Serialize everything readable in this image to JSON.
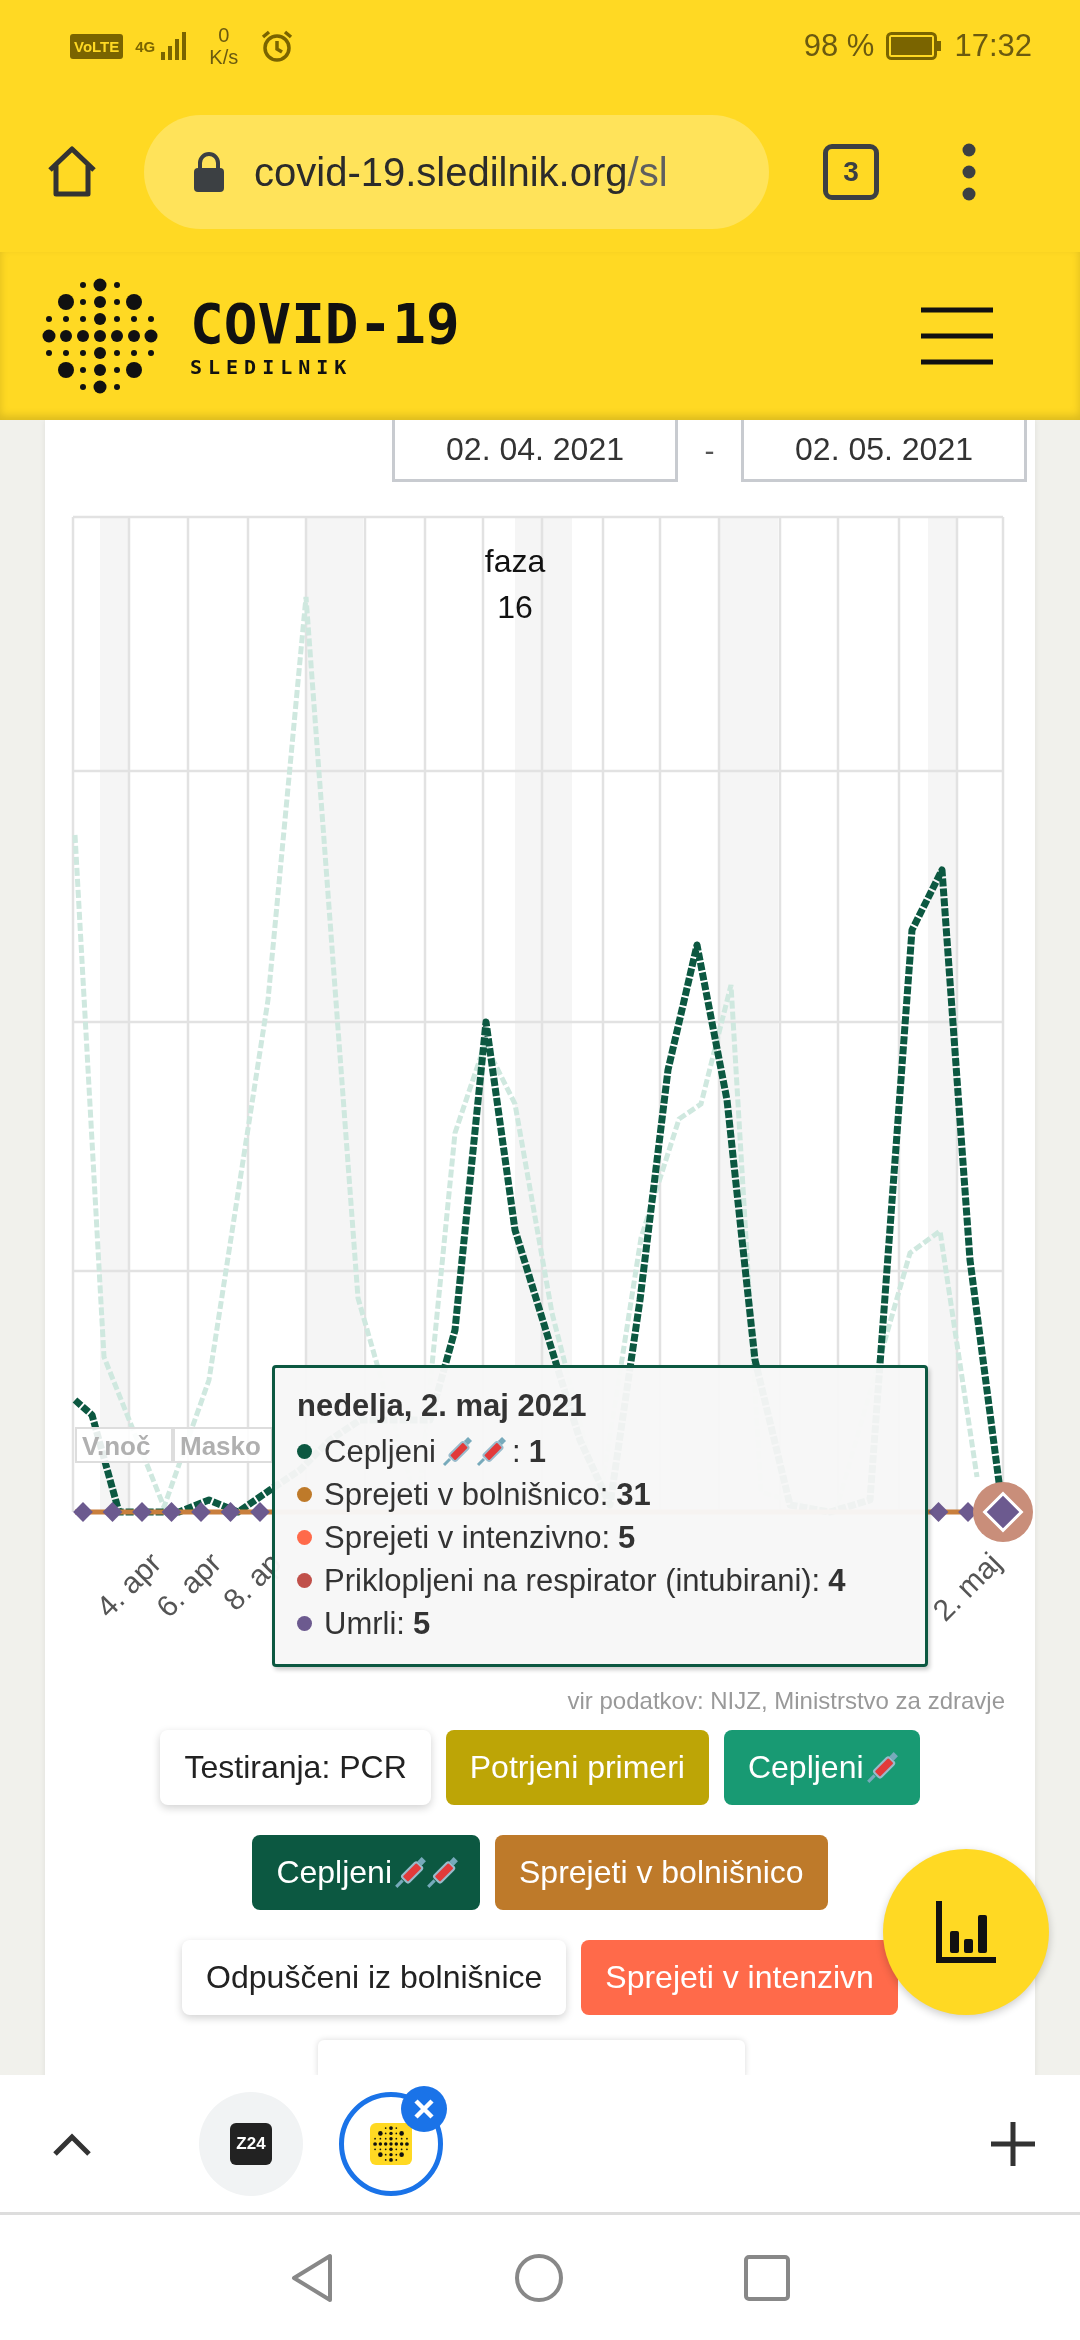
{
  "status_bar": {
    "network_badge": "VoLTE",
    "network_type": "4G",
    "speed_value": "0",
    "speed_unit": "K/s",
    "battery_percent": "98 %",
    "time": "17:32"
  },
  "browser": {
    "url_host": "covid-19.sledilnik.org",
    "url_path": "/sl",
    "tab_count": "3"
  },
  "site_header": {
    "title": "COVID-19",
    "subtitle": "SLEDILNIK"
  },
  "date_range": {
    "from": "02. 04. 2021",
    "separator": "-",
    "to": "02. 05. 2021"
  },
  "chart": {
    "phase_label": "faza 16",
    "period_labels": [
      "V.noč",
      "Masko"
    ],
    "x_labels": [
      "4. apr",
      "6. apr",
      "8. ap",
      "2. maj"
    ],
    "tooltip": {
      "title": "nedelja, 2. maj 2021",
      "items": [
        {
          "label": "Cepljeni",
          "kind": "dose2",
          "label_end": ":",
          "value": "1",
          "color": "#0c5841"
        },
        {
          "label": "Sprejeti v bolnišnico:",
          "kind": "plain",
          "value": "31",
          "color": "#be7a2a"
        },
        {
          "label": "Sprejeti v intenzivno:",
          "kind": "plain",
          "value": "5",
          "color": "#ff6a4a"
        },
        {
          "label": "Priklopljeni na respirator (intubirani):",
          "kind": "plain",
          "value": "4",
          "color": "#c0504a"
        },
        {
          "label": "Umrli:",
          "kind": "plain",
          "value": "5",
          "color": "#6c5a8f"
        }
      ]
    }
  },
  "source": "vir podatkov: NIJZ, Ministrstvo za zdravje",
  "series_buttons": [
    {
      "label": "Testiranja: PCR",
      "kind": "plain",
      "selected": false
    },
    {
      "label": "Potrjeni primeri",
      "kind": "plain",
      "selected": true,
      "color": "#bda506"
    },
    {
      "label": "Cepljeni",
      "kind": "dose1",
      "selected": true,
      "color": "#189a73"
    },
    {
      "label": "Cepljeni",
      "kind": "dose2",
      "selected": true,
      "color": "#0c5841"
    },
    {
      "label": "Sprejeti v bolnišnico",
      "kind": "plain",
      "selected": true,
      "color": "#be7a2a"
    },
    {
      "label": "Odpuščeni iz bolnišnice",
      "kind": "plain",
      "selected": false
    },
    {
      "label": "Sprejeti v intenzivn",
      "kind": "plain",
      "selected": true,
      "color": "#ff6a4a"
    }
  ],
  "tab_strip": {
    "tabs": [
      {
        "favicon_text": "Z24",
        "selected": false
      },
      {
        "selected": true
      }
    ]
  }
}
